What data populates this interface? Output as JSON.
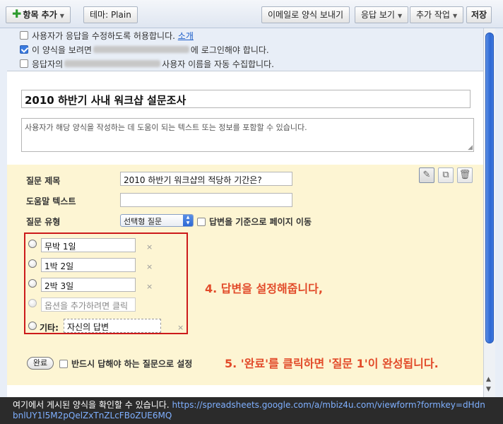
{
  "toolbar": {
    "add_item": "항목 추가",
    "theme": "테마: Plain",
    "email_form": "이메일로 양식 보내기",
    "view_responses": "응답 보기",
    "more_actions": "추가 작업",
    "save": "저장"
  },
  "settings": {
    "allow_edit": "사용자가 응답을 수정하도록 허용합니다.",
    "allow_edit_link": "소개",
    "require_login_prefix": "이 양식을 보려면",
    "require_login_suffix": "에 로그인해야 합니다.",
    "collect_prefix": "응답자의",
    "collect_suffix": "사용자 이름을 자동 수집합니다."
  },
  "form": {
    "title": "2010 하반기 사내 워크샵 설문조사",
    "description": "사용자가 해당 양식을 작성하는 데 도움이 되는 텍스트 또는 정보를 포함할 수 있습니다."
  },
  "question": {
    "title_label": "질문 제목",
    "title_value": "2010 하반기 워크샵의 적당하 기간은?",
    "help_label": "도움말 텍스트",
    "help_value": "",
    "type_label": "질문 유형",
    "type_value": "선택형 질문",
    "page_nav": "답변을 기준으로 페이지 이동",
    "options": [
      "무박 1일",
      "1박 2일",
      "2박 3일"
    ],
    "add_option_placeholder": "옵션을 추가하려면 클릭",
    "other_label": "기타:",
    "other_value": "자신의 답변",
    "done_button": "완료",
    "required_label": "반드시 답해야 하는 질문으로 설정"
  },
  "annotations": {
    "step4": "4. 답변을 설정해줍니다,",
    "step5": "5. '완료'를 클릭하면 '질문 1'이 완성됩니다."
  },
  "footer": {
    "text": "여기에서 게시된 양식을 확인할 수 있습니다.",
    "url": "https://spreadsheets.google.com/a/mbiz4u.com/viewform?formkey=dHdnbnlUY1l5M2pQelZxTnZLcFBoZUE6MQ"
  },
  "colors": {
    "question_bg": "#fdf5d3",
    "annotation": "#e24b2a",
    "highlight_box": "#cc1a1a"
  }
}
